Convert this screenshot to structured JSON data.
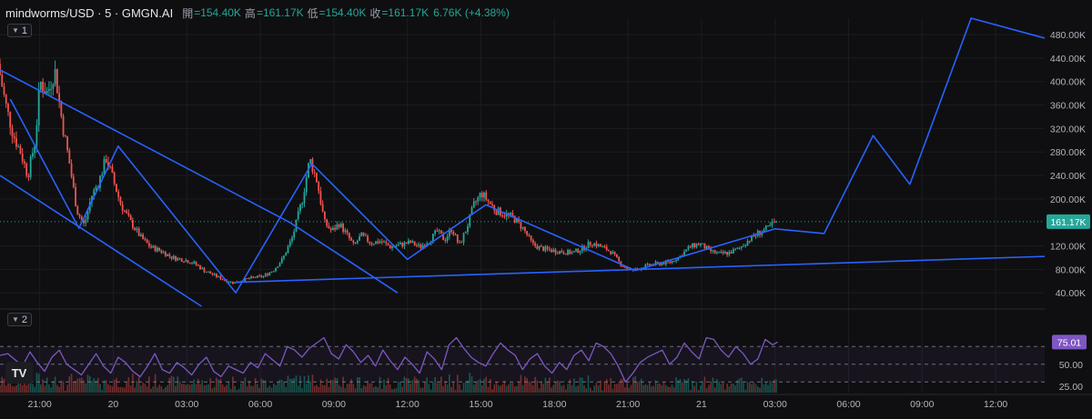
{
  "header": {
    "symbol": "mindworms/USD · 5 · GMGN.AI",
    "open_label": "開",
    "open_value": "=154.40K",
    "high_label": "高",
    "high_value": "=161.17K",
    "low_label": "低",
    "low_value": "=154.40K",
    "close_label": "收",
    "close_value": "=161.17K",
    "change": "6.76K (+4.38%)"
  },
  "panes": {
    "main_label": "1",
    "osc_label": "2"
  },
  "logo_text": "TV",
  "colors": {
    "up": "#26a69a",
    "down": "#ef5350",
    "line": "#2962ff",
    "rsi": "#7e57c2",
    "last_price": "#26a69a"
  },
  "chart_data": [
    {
      "type": "candlestick",
      "y_axis_ticks": [
        "480.00K",
        "440.00K",
        "400.00K",
        "360.00K",
        "320.00K",
        "280.00K",
        "240.00K",
        "200.00K",
        "120.00K",
        "80.00K",
        "40.00K"
      ],
      "y_tick_values": [
        480,
        440,
        400,
        360,
        320,
        280,
        240,
        200,
        120,
        80,
        40
      ],
      "ylim": [
        17,
        508
      ],
      "x_axis_ticks": [
        "21:00",
        "20",
        "03:00",
        "06:00",
        "09:00",
        "12:00",
        "15:00",
        "18:00",
        "21:00",
        "21",
        "03:00",
        "06:00",
        "09:00",
        "12:00"
      ],
      "x_tick_hours": [
        -3,
        0,
        3,
        6,
        9,
        12,
        15,
        18,
        21,
        24,
        27,
        30,
        33,
        36
      ],
      "xlim_hours": [
        -4.62,
        38.0
      ],
      "last_price": 161.17,
      "last_price_label": "161.17K",
      "price_path": [
        [
          -4.62,
          430
        ],
        [
          -4.3,
          360
        ],
        [
          -4.0,
          310
        ],
        [
          -3.7,
          280
        ],
        [
          -3.4,
          240
        ],
        [
          -3.1,
          300
        ],
        [
          -2.9,
          400
        ],
        [
          -2.6,
          380
        ],
        [
          -2.3,
          420
        ],
        [
          -2.0,
          330
        ],
        [
          -1.7,
          260
        ],
        [
          -1.4,
          180
        ],
        [
          -1.1,
          155
        ],
        [
          -0.8,
          205
        ],
        [
          -0.5,
          230
        ],
        [
          -0.2,
          270
        ],
        [
          0.1,
          230
        ],
        [
          0.4,
          190
        ],
        [
          0.8,
          160
        ],
        [
          1.2,
          135
        ],
        [
          1.6,
          118
        ],
        [
          2.0,
          112
        ],
        [
          2.5,
          100
        ],
        [
          3.0,
          96
        ],
        [
          3.4,
          90
        ],
        [
          3.8,
          78
        ],
        [
          4.2,
          70
        ],
        [
          4.6,
          62
        ],
        [
          5.0,
          57
        ],
        [
          5.4,
          62
        ],
        [
          5.8,
          66
        ],
        [
          6.2,
          68
        ],
        [
          6.6,
          78
        ],
        [
          7.0,
          98
        ],
        [
          7.4,
          135
        ],
        [
          7.8,
          200
        ],
        [
          8.1,
          268
        ],
        [
          8.4,
          230
        ],
        [
          8.7,
          160
        ],
        [
          9.0,
          145
        ],
        [
          9.3,
          158
        ],
        [
          9.6,
          140
        ],
        [
          9.9,
          120
        ],
        [
          10.2,
          138
        ],
        [
          10.6,
          125
        ],
        [
          11.0,
          128
        ],
        [
          11.4,
          118
        ],
        [
          11.8,
          122
        ],
        [
          12.2,
          126
        ],
        [
          12.6,
          118
        ],
        [
          13.0,
          130
        ],
        [
          13.3,
          145
        ],
        [
          13.6,
          130
        ],
        [
          13.9,
          150
        ],
        [
          14.2,
          120
        ],
        [
          14.5,
          150
        ],
        [
          14.8,
          190
        ],
        [
          15.1,
          210
        ],
        [
          15.4,
          195
        ],
        [
          15.7,
          180
        ],
        [
          16.0,
          175
        ],
        [
          16.4,
          168
        ],
        [
          16.8,
          150
        ],
        [
          17.2,
          122
        ],
        [
          17.6,
          115
        ],
        [
          18.0,
          112
        ],
        [
          18.4,
          110
        ],
        [
          18.8,
          108
        ],
        [
          19.2,
          115
        ],
        [
          19.6,
          126
        ],
        [
          20.0,
          118
        ],
        [
          20.4,
          110
        ],
        [
          20.8,
          88
        ],
        [
          21.2,
          78
        ],
        [
          21.6,
          82
        ],
        [
          22.0,
          88
        ],
        [
          22.4,
          90
        ],
        [
          22.8,
          92
        ],
        [
          23.2,
          102
        ],
        [
          23.6,
          118
        ],
        [
          24.0,
          124
        ],
        [
          24.4,
          112
        ],
        [
          24.8,
          106
        ],
        [
          25.2,
          108
        ],
        [
          25.6,
          115
        ],
        [
          26.0,
          130
        ],
        [
          26.4,
          142
        ],
        [
          26.8,
          150
        ],
        [
          27.1,
          161.17
        ]
      ],
      "drawings": [
        {
          "name": "channel-upper-line",
          "points": [
            [
              -4.62,
              420
            ],
            [
              7.2,
              160
            ],
            [
              11.6,
              40
            ]
          ]
        },
        {
          "name": "channel-lower-line",
          "points": [
            [
              -4.62,
              240
            ],
            [
              3.6,
              17
            ]
          ]
        },
        {
          "name": "zigzag-line",
          "points": [
            [
              -4.2,
              370
            ],
            [
              -1.4,
              150
            ],
            [
              0.2,
              290
            ],
            [
              5.0,
              40
            ],
            [
              8.1,
              260
            ],
            [
              12.0,
              97
            ],
            [
              15.2,
              190
            ],
            [
              21.3,
              78
            ]
          ]
        },
        {
          "name": "support-trendline",
          "points": [
            [
              5.0,
              58
            ],
            [
              38.0,
              102
            ]
          ]
        },
        {
          "name": "projection-line",
          "points": [
            [
              21.3,
              78
            ],
            [
              27.0,
              149
            ],
            [
              29.0,
              141
            ],
            [
              31.0,
              308
            ],
            [
              32.5,
              225
            ],
            [
              35.0,
              508
            ],
            [
              38.0,
              474
            ]
          ]
        }
      ]
    },
    {
      "type": "line",
      "name": "oscillator",
      "y_axis_ticks": [
        "75.01",
        "50.00",
        "25.00"
      ],
      "y_tick_values": [
        75.01,
        50,
        25
      ],
      "ylim": [
        18,
        100
      ],
      "bands": [
        70,
        50,
        30
      ],
      "last_value": 75.01,
      "last_value_label": "75.01",
      "x_hours": [
        -4.62,
        -4.3,
        -4.0,
        -3.7,
        -3.4,
        -3.1,
        -2.8,
        -2.5,
        -2.2,
        -1.9,
        -1.6,
        -1.3,
        -1.0,
        -0.7,
        -0.4,
        -0.1,
        0.2,
        0.5,
        0.8,
        1.1,
        1.4,
        1.7,
        2.0,
        2.3,
        2.6,
        2.9,
        3.2,
        3.5,
        3.8,
        4.1,
        4.4,
        4.7,
        5.0,
        5.3,
        5.6,
        5.9,
        6.2,
        6.5,
        6.8,
        7.1,
        7.4,
        7.7,
        8.0,
        8.3,
        8.6,
        8.9,
        9.2,
        9.5,
        9.8,
        10.1,
        10.4,
        10.7,
        11.0,
        11.3,
        11.6,
        11.9,
        12.2,
        12.5,
        12.8,
        13.1,
        13.4,
        13.7,
        14.0,
        14.3,
        14.6,
        14.9,
        15.2,
        15.5,
        15.8,
        16.1,
        16.4,
        16.7,
        17.0,
        17.3,
        17.6,
        17.9,
        18.2,
        18.5,
        18.8,
        19.1,
        19.4,
        19.7,
        20.0,
        20.3,
        20.6,
        20.9,
        21.2,
        21.5,
        21.8,
        22.1,
        22.4,
        22.7,
        23.0,
        23.3,
        23.6,
        23.9,
        24.2,
        24.5,
        24.8,
        25.1,
        25.4,
        25.7,
        26.0,
        26.3,
        26.6,
        26.9,
        27.1
      ],
      "values": [
        60,
        62,
        55,
        48,
        64,
        52,
        42,
        58,
        66,
        50,
        44,
        38,
        50,
        62,
        48,
        40,
        58,
        52,
        42,
        36,
        48,
        62,
        44,
        40,
        52,
        46,
        38,
        50,
        58,
        42,
        36,
        48,
        44,
        40,
        52,
        46,
        62,
        55,
        48,
        70,
        66,
        58,
        68,
        74,
        80,
        62,
        56,
        72,
        64,
        52,
        60,
        48,
        66,
        54,
        44,
        58,
        50,
        40,
        64,
        56,
        44,
        72,
        80,
        68,
        58,
        52,
        48,
        62,
        74,
        66,
        60,
        44,
        56,
        62,
        48,
        40,
        52,
        44,
        60,
        66,
        54,
        74,
        70,
        62,
        48,
        30,
        40,
        52,
        58,
        62,
        66,
        50,
        58,
        74,
        64,
        56,
        80,
        78,
        66,
        58,
        70,
        62,
        50,
        56,
        78,
        72,
        75.01
      ]
    }
  ]
}
